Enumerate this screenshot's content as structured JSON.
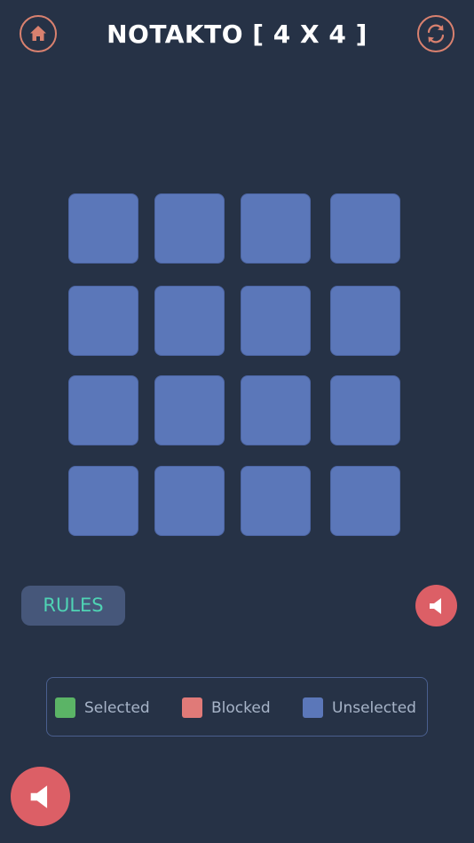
{
  "colors": {
    "background": "#263246",
    "accent": "#d9816f",
    "tile_unselected": "#5b77b9",
    "selected": "#5bb466",
    "blocked": "#e07a78",
    "unselected": "#5b77b9",
    "rules_text": "#4fd3b4",
    "sound_button": "#dc5f66"
  },
  "header": {
    "title": "NOTAKTO [ 4 X 4 ]",
    "home_icon": "home-icon",
    "reset_icon": "refresh-icon"
  },
  "board": {
    "rows": 4,
    "cols": 4,
    "cells": [
      [
        "unselected",
        "unselected",
        "unselected",
        "unselected"
      ],
      [
        "unselected",
        "unselected",
        "unselected",
        "unselected"
      ],
      [
        "unselected",
        "unselected",
        "unselected",
        "unselected"
      ],
      [
        "unselected",
        "unselected",
        "unselected",
        "unselected"
      ]
    ]
  },
  "controls": {
    "rules_label": "RULES",
    "sound_icon": "speaker-icon"
  },
  "legend": {
    "items": [
      {
        "label": "Selected",
        "color": "#5bb466"
      },
      {
        "label": "Blocked",
        "color": "#e07a78"
      },
      {
        "label": "Unselected",
        "color": "#5b77b9"
      }
    ]
  }
}
